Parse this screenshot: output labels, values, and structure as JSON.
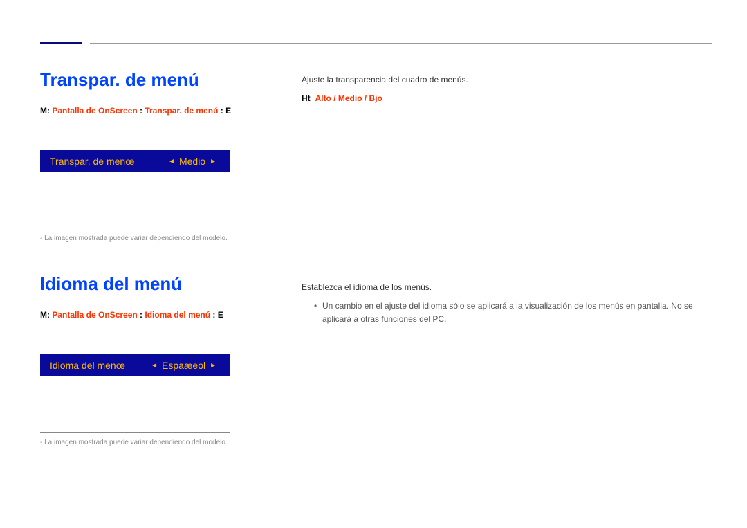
{
  "section1": {
    "heading": "Transpar. de menú",
    "breadcrumb": {
      "p1": "M: ",
      "p2": "Pantalla de OnScreen",
      "p3": " : ",
      "p4": "Transpar. de menú",
      "p5": " : E"
    },
    "setting_label": "Transpar. de menœ",
    "setting_value": "Medio",
    "note": "- La imagen mostrada puede variar dependiendo del modelo.",
    "desc": "Ajuste la transparencia del cuadro de menús.",
    "options_prefix": "Ht",
    "options": "Alto / Medio / Bjo"
  },
  "section2": {
    "heading": "Idioma del menú",
    "breadcrumb": {
      "p1": "M: ",
      "p2": "Pantalla de OnScreen",
      "p3": " : ",
      "p4": "Idioma del menú",
      "p5": " : E"
    },
    "setting_label": "Idioma del menœ",
    "setting_value": "Espaæeol",
    "note": "- La imagen mostrada puede variar dependiendo del modelo.",
    "desc": "Establezca el idioma de los menús.",
    "bullet": "Un cambio en el ajuste del idioma sólo se aplicará a la visualización de los menús en pantalla. No se aplicará a otras funciones del PC."
  }
}
